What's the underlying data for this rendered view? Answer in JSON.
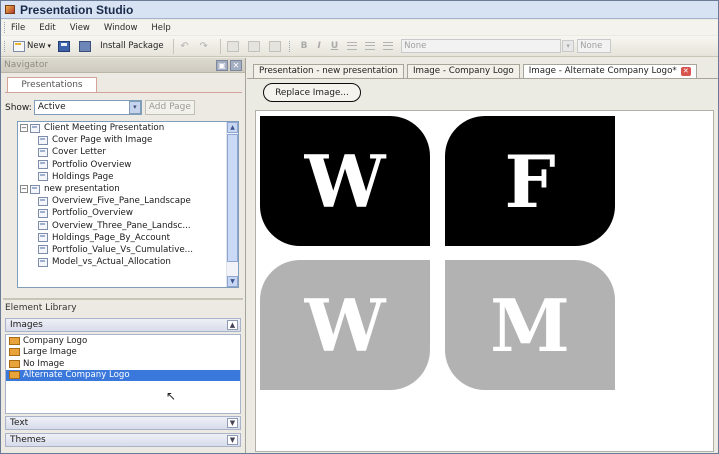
{
  "window": {
    "title": "Presentation Studio"
  },
  "menu": [
    "File",
    "Edit",
    "View",
    "Window",
    "Help"
  ],
  "toolbar": {
    "new_label": "New",
    "install_label": "Install Package",
    "font_name": "None",
    "font_size": "None"
  },
  "navigator": {
    "title": "Navigator",
    "tab": "Presentations",
    "show_label": "Show:",
    "show_value": "Active",
    "add_page": "Add Page",
    "tree": [
      {
        "label": "Client Meeting Presentation",
        "level": 0,
        "expanded": true
      },
      {
        "label": "Cover Page with Image",
        "level": 1
      },
      {
        "label": "Cover Letter",
        "level": 1
      },
      {
        "label": "Portfolio Overview",
        "level": 1
      },
      {
        "label": "Holdings Page",
        "level": 1
      },
      {
        "label": "new presentation",
        "level": 0,
        "expanded": true
      },
      {
        "label": "Overview_Five_Pane_Landscape",
        "level": 1
      },
      {
        "label": "Portfolio_Overview",
        "level": 1
      },
      {
        "label": "Overview_Three_Pane_Landsc...",
        "level": 1
      },
      {
        "label": "Holdings_Page_By_Account",
        "level": 1
      },
      {
        "label": "Portfolio_Value_Vs_Cumulative...",
        "level": 1
      },
      {
        "label": "Model_vs_Actual_Allocation",
        "level": 1
      }
    ]
  },
  "element_library": {
    "title": "Element Library",
    "images_header": "Images",
    "images": [
      "Company Logo",
      "Large Image",
      "No Image",
      "Alternate Company Logo"
    ],
    "selected_index": 3,
    "text_header": "Text",
    "themes_header": "Themes"
  },
  "tabs": [
    {
      "label": "Presentation - new presentation",
      "active": false
    },
    {
      "label": "Image - Company Logo",
      "active": false
    },
    {
      "label": "Image - Alternate Company Logo*",
      "active": true
    }
  ],
  "replace_button": "Replace Image...",
  "logo": {
    "letters": [
      "W",
      "F",
      "W",
      "M"
    ],
    "dark": "#000000",
    "light": "#b2b2b2"
  }
}
